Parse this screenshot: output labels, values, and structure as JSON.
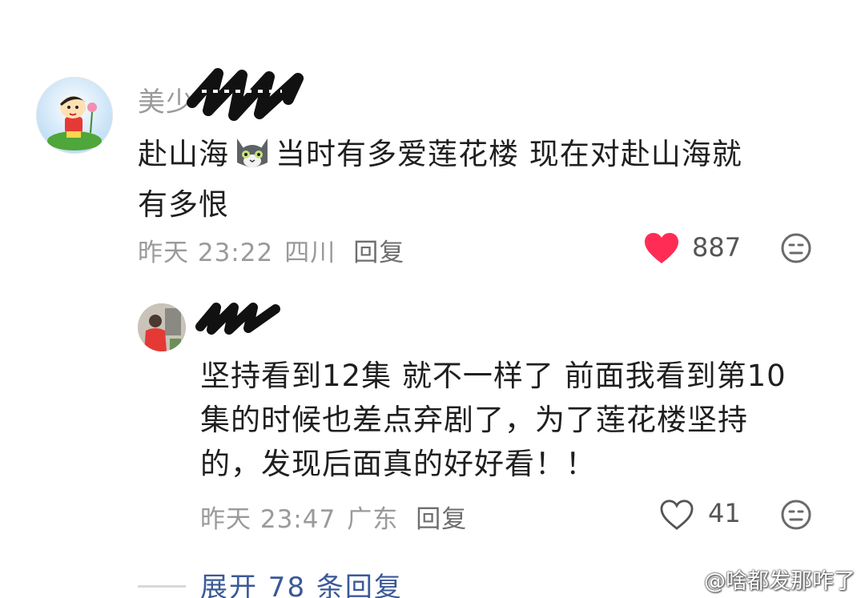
{
  "comment": {
    "username": "美少",
    "text_line1_prefix": "赴山海",
    "text_line1_suffix": "当时有多爱莲花楼 现在对赴山海就",
    "text_line2": "有多恨",
    "timestamp": "昨天 23:22",
    "location": "四川",
    "reply_label": "回复",
    "like_count": "887",
    "liked": true,
    "icons": [
      "heart-filled-icon",
      "dislike-face-icon",
      "cat-emoji-icon"
    ],
    "colors": {
      "like": "#ff2d55"
    }
  },
  "reply": {
    "username": "",
    "text_line1": "坚持看到12集 就不一样了 前面我看到第10",
    "text_line2": "集的时候也差点弃剧了，为了莲花楼坚持",
    "text_line3": "的，发现后面真的好好看！！",
    "timestamp": "昨天 23:47",
    "location": "广东",
    "reply_label": "回复",
    "like_count": "41",
    "liked": false,
    "icons": [
      "heart-outline-icon",
      "dislike-face-icon"
    ]
  },
  "expand_replies_label": "展开 78 条回复",
  "watermark": "@啥都发那咋了",
  "link_color": "#3b5998"
}
